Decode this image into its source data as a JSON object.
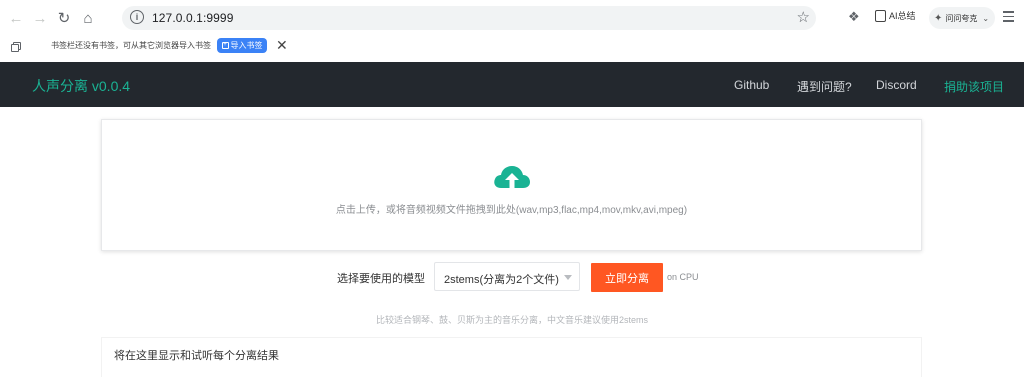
{
  "browser": {
    "url": "127.0.0.1:9999",
    "ai_summary_label": "AI总结",
    "ask_label": "问问夸克"
  },
  "bookmarks_bar": {
    "message": "书签栏还没有书签，可从其它浏览器导入书签",
    "import_label": "导入书签"
  },
  "app_nav": {
    "brand": "人声分离 v0.0.4",
    "links": [
      "Github",
      "遇到问题?",
      "Discord",
      "捐助该项目"
    ]
  },
  "upload": {
    "prompt": "点击上传，或将音频视频文件拖拽到此处(wav,mp3,flac,mp4,mov,mkv,avi,mpeg)"
  },
  "model": {
    "label": "选择要使用的模型",
    "selected": "2stems(分离为2个文件)",
    "button_label": "立即分离",
    "device_note": "on CPU",
    "hint": "比较适合钢琴、鼓、贝斯为主的音乐分离，中文音乐建议使用2stems"
  },
  "results": {
    "title": "将在这里显示和试听每个分离结果"
  },
  "colors": {
    "accent": "#1ab394",
    "primary_button": "#ff5722",
    "nav_background": "#23282e"
  }
}
